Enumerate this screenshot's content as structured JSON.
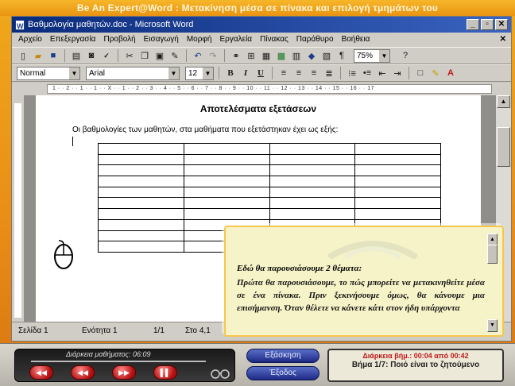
{
  "banner": {
    "title": "Be An Expert@Word :    Μετακίνηση μέσα σε πίνακα και επιλογή τμημάτων του"
  },
  "window": {
    "title": "Βαθμολογία μαθητών.doc - Microsoft Word",
    "controls": [
      "_",
      "▫",
      "✕"
    ]
  },
  "menubar": {
    "items": [
      "Αρχείο",
      "Επεξεργασία",
      "Προβολή",
      "Εισαγωγή",
      "Μορφή",
      "Εργαλεία",
      "Πίνακας",
      "Παράθυρο",
      "Βοήθεια"
    ],
    "close": "✕"
  },
  "toolbar_standard": {
    "zoom": "75%",
    "undo_icon": "undo-arrow",
    "redo_icon": "redo-arrow"
  },
  "toolbar_formatting": {
    "style": "Normal",
    "font": "Arial",
    "size": "12",
    "bold": "B",
    "italic": "I",
    "underline": "U"
  },
  "ruler": {
    "scale": "1 · · 2 · · 1 · · 1 · · X · · 1 · · 2 · · 3 · · 4 · · 5 · · 6 · · 7 · · 8 · · 9 · · 10 · · 11 · · 12 · · 13 · · 14 · · 15 · · 16 · · 17"
  },
  "document": {
    "title": "Αποτελέσματα εξετάσεων",
    "intro": "Οι βαθμολογίες των μαθητών, στα μαθήματα που εξετάστηκαν έχει ως εξής:",
    "table_rows": 10,
    "table_cols": 4
  },
  "statusbar": {
    "page": "Σελίδα 1",
    "section": "Ενότητα 1",
    "page_of": "1/1",
    "position": "Στο 4,1"
  },
  "tip": {
    "heading": "Εδώ θα παρουσιάσουμε 2 θέματα:",
    "body": "Πρώτα θα παρουσιάσουμε, το πώς μπορείτε να μετακινηθείτε μέσα σε ένα πίνακα. Πριν ξεκινήσουμε όμως, θα κάνουμε μια επισήμανση. Όταν θέλετε να κάνετε κάτι στον ήδη υπάρχοντα"
  },
  "player": {
    "label": "Διάρκεια μαθήματος: 06:09",
    "buttons": [
      "◀◀",
      "◀◀",
      "▶▶",
      "▌▌"
    ]
  },
  "nav": {
    "exercise": "Εξάσκηση",
    "exit": "Έξοδος"
  },
  "step": {
    "duration": "Διάρκεια βήμ.: 00:04 από 00:42",
    "title": "Βήμα 1/7: Ποιό είναι το ζητούμενο"
  }
}
